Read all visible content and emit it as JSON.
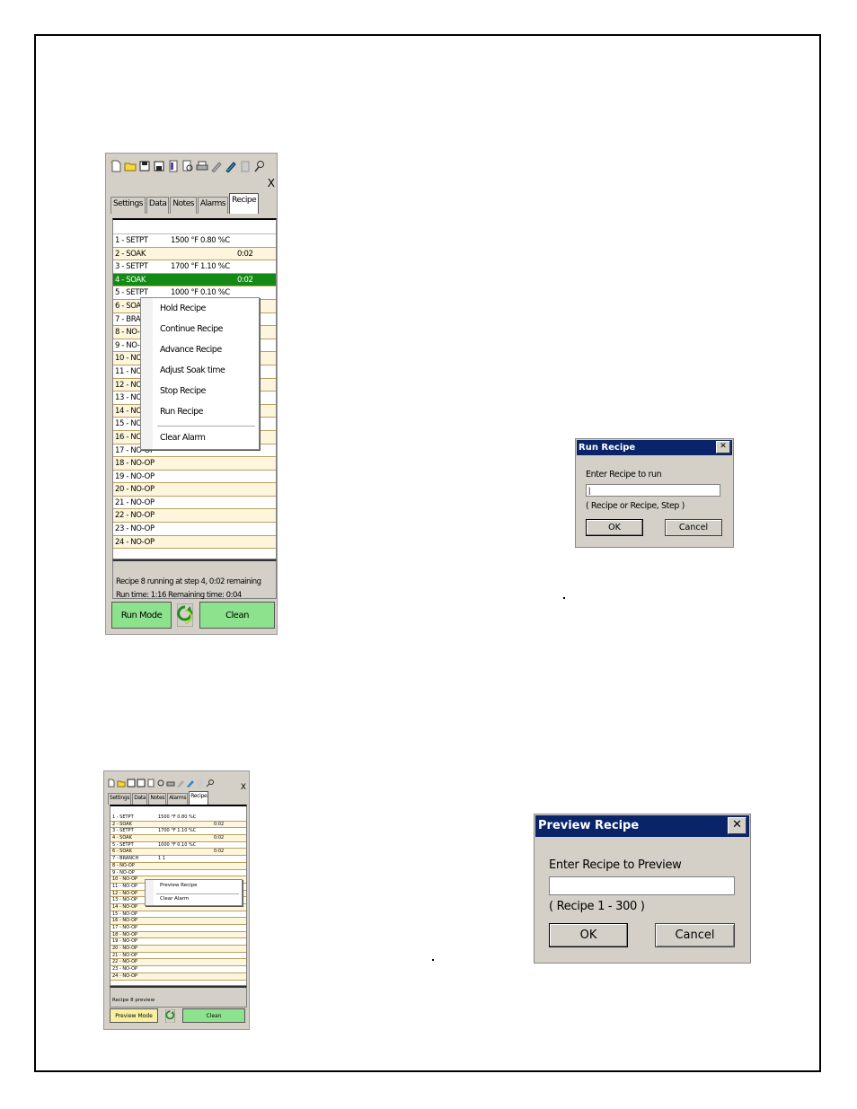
{
  "panel1": {
    "close_label": "X",
    "tabs": [
      "Settings",
      "Data",
      "Notes",
      "Alarms",
      "Recipe"
    ],
    "active_tab": "Recipe",
    "rows": [
      {
        "step": "1 - SETPT",
        "value": "1500 °F 0.80 %C",
        "time": ""
      },
      {
        "step": "2 - SOAK",
        "value": "",
        "time": "0:02"
      },
      {
        "step": "3 - SETPT",
        "value": "1700 °F 1.10 %C",
        "time": ""
      },
      {
        "step": "4 - SOAK",
        "value": "",
        "time": "0:02"
      },
      {
        "step": "5 - SETPT",
        "value": "1000 °F 0.10 %C",
        "time": ""
      },
      {
        "step": "6 - SOAK",
        "value": "",
        "time": ""
      },
      {
        "step": "7 - BRANCH",
        "value": "",
        "time": ""
      },
      {
        "step": "8 - NO-OP",
        "value": "",
        "time": ""
      },
      {
        "step": "9 - NO-OP",
        "value": "",
        "time": ""
      },
      {
        "step": "10 - NO-OP",
        "value": "",
        "time": ""
      },
      {
        "step": "11 - NO-OP",
        "value": "",
        "time": ""
      },
      {
        "step": "12 - NO-OP",
        "value": "",
        "time": ""
      },
      {
        "step": "13 - NO-OP",
        "value": "",
        "time": ""
      },
      {
        "step": "14 - NO-OP",
        "value": "",
        "time": ""
      },
      {
        "step": "15 - NO-OP",
        "value": "",
        "time": ""
      },
      {
        "step": "16 - NO-OP",
        "value": "",
        "time": ""
      },
      {
        "step": "17 - NO-OP",
        "value": "",
        "time": ""
      },
      {
        "step": "18 - NO-OP",
        "value": "",
        "time": ""
      },
      {
        "step": "19 - NO-OP",
        "value": "",
        "time": ""
      },
      {
        "step": "20 - NO-OP",
        "value": "",
        "time": ""
      },
      {
        "step": "21 - NO-OP",
        "value": "",
        "time": ""
      },
      {
        "step": "22 - NO-OP",
        "value": "",
        "time": ""
      },
      {
        "step": "23 - NO-OP",
        "value": "",
        "time": ""
      },
      {
        "step": "24 - NO-OP",
        "value": "",
        "time": ""
      }
    ],
    "selected_row": 3,
    "status_line1": "Recipe 8 running at step 4, 0:02 remaining",
    "status_line2": "Run time: 1:16 Remaining time: 0:04",
    "mode_button": "Run Mode",
    "clean_button": "Clean",
    "context_menu": [
      "Hold Recipe",
      "Continue Recipe",
      "Advance Recipe",
      "Adjust Soak time",
      "Stop Recipe",
      "Run Recipe",
      "Clear Alarm"
    ]
  },
  "run_dialog": {
    "title": "Run Recipe",
    "close": "✕",
    "label": "Enter Recipe to run",
    "input_value": "|",
    "hint": "( Recipe or Recipe, Step )",
    "ok": "OK",
    "cancel": "Cancel"
  },
  "panel2": {
    "close_label": "X",
    "tabs": [
      "Settings",
      "Data",
      "Notes",
      "Alarms",
      "Recipe"
    ],
    "active_tab": "Recipe",
    "rows": [
      {
        "step": "1 - SETPT",
        "value": "1500 °F 0.80 %C",
        "time": ""
      },
      {
        "step": "2 - SOAK",
        "value": "",
        "time": "0:02"
      },
      {
        "step": "3 - SETPT",
        "value": "1700 °F 1.10 %C",
        "time": ""
      },
      {
        "step": "4 - SOAK",
        "value": "",
        "time": "0:02"
      },
      {
        "step": "5 - SETPT",
        "value": "1000 °F 0.10 %C",
        "time": ""
      },
      {
        "step": "6 - SOAK",
        "value": "",
        "time": "0:02"
      },
      {
        "step": "7 - BRANCH",
        "value": "1        1",
        "time": ""
      },
      {
        "step": "8 - NO-OP",
        "value": "",
        "time": ""
      },
      {
        "step": "9 - NO-OP",
        "value": "",
        "time": ""
      },
      {
        "step": "10 - NO-OP",
        "value": "",
        "time": ""
      },
      {
        "step": "11 - NO-OP",
        "value": "",
        "time": ""
      },
      {
        "step": "12 - NO-OP",
        "value": "",
        "time": ""
      },
      {
        "step": "13 - NO-OP",
        "value": "",
        "time": ""
      },
      {
        "step": "14 - NO-OP",
        "value": "",
        "time": ""
      },
      {
        "step": "15 - NO-OP",
        "value": "",
        "time": ""
      },
      {
        "step": "16 - NO-OP",
        "value": "",
        "time": ""
      },
      {
        "step": "17 - NO-OP",
        "value": "",
        "time": ""
      },
      {
        "step": "18 - NO-OP",
        "value": "",
        "time": ""
      },
      {
        "step": "19 - NO-OP",
        "value": "",
        "time": ""
      },
      {
        "step": "20 - NO-OP",
        "value": "",
        "time": ""
      },
      {
        "step": "21 - NO-OP",
        "value": "",
        "time": ""
      },
      {
        "step": "22 - NO-OP",
        "value": "",
        "time": ""
      },
      {
        "step": "23 - NO-OP",
        "value": "",
        "time": ""
      },
      {
        "step": "24 - NO-OP",
        "value": "",
        "time": ""
      }
    ],
    "status_line1": "Recipe 8 preview",
    "mode_button": "Preview Mode",
    "clean_button": "Clean",
    "context_menu": [
      "Preview Recipe",
      "Clear Alarm"
    ]
  },
  "preview_dialog": {
    "title": "Preview Recipe",
    "close": "✕",
    "label": "Enter Recipe to Preview",
    "input_value": "",
    "hint": "( Recipe 1 - 300 )",
    "ok": "OK",
    "cancel": "Cancel"
  },
  "colors": {
    "selected_row": "#138a13",
    "green_button": "#8de38d",
    "preview_button": "#f7f0a0",
    "dialog_titlebar": "#0a246a",
    "row_alt": "#fdf6dc"
  },
  "icons": [
    "new-file-icon",
    "open-folder-icon",
    "save-icon",
    "save-as-icon",
    "properties-icon",
    "print-preview-icon",
    "print-icon",
    "edit-icon",
    "pen-icon",
    "delete-icon",
    "find-icon",
    "refresh-icon"
  ]
}
